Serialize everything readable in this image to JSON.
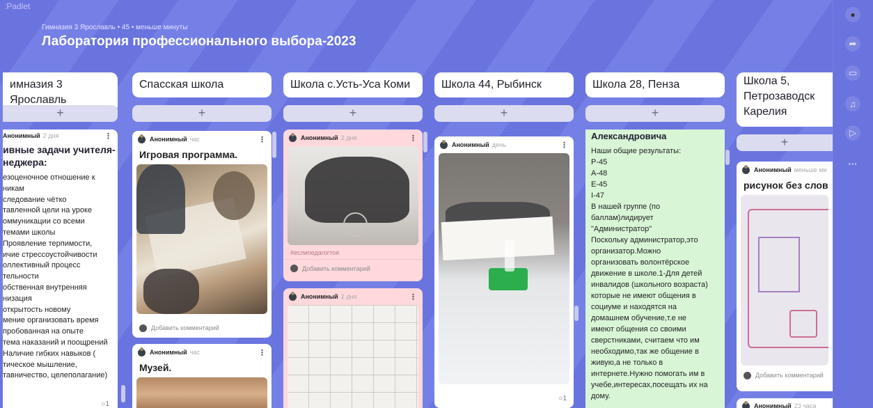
{
  "brand": ":Padlet",
  "breadcrumb": "Гимназия 3 Ярославль • 45 • меньше минуты",
  "title": "Лаборатория профессионального выбора-2023",
  "add_symbol": "+",
  "more_symbol": "⋮",
  "rail": {
    "share_icon": "share-icon",
    "present_icon": "slideshow-icon",
    "notify_icon": "bell-icon",
    "play_icon": "play-icon",
    "more": "···"
  },
  "columns": [
    {
      "heading": "имназия 3 Ярославль"
    },
    {
      "heading": "Спасская школа"
    },
    {
      "heading": "Школа с.Усть-Уса Коми"
    },
    {
      "heading": "Школа 44, Рыбинск"
    },
    {
      "heading": "Школа 28, Пенза"
    },
    {
      "heading": "Школа 5, Петрозаводск Карелия"
    }
  ],
  "col1": {
    "author": "Анонимный",
    "time": "2 дня",
    "title": "ивные задачи учителя-\nнеджера:",
    "lines": [
      "езоценочное отношение к",
      "никам",
      "следование чётко",
      "тавленной цели на уроке",
      "оммуникации со всеми",
      "темами школы",
      "Проявление терпимости,",
      "ичие стрессоустойчивости",
      "оллективный процесс",
      "тельности",
      "обственная внутренняя",
      "низация",
      "открытость новому",
      "мение организовать время",
      "пробованная на опыте",
      "тема наказаний и поощрений",
      "Наличие гибких навыков (",
      "тическое мышление,",
      "тавничество, целеполагание)"
    ],
    "comment_count": "1"
  },
  "col2": {
    "card1": {
      "author": "Анонимный",
      "time": "час",
      "title": "Игровая программа.",
      "comment": "Добавить комментарий"
    },
    "card2": {
      "author": "Анонимный",
      "time": "час",
      "title": "Музей."
    }
  },
  "col3": {
    "card1": {
      "author": "Анонимный",
      "time": "2 дня",
      "tag": "#еслипедагогтоя",
      "comment": "Добавить комментарий"
    },
    "card2": {
      "author": "Анонимный",
      "time": "2 дня"
    }
  },
  "col4": {
    "card1": {
      "author": "Анонимный",
      "time": "день",
      "comment_count": "1"
    }
  },
  "col5": {
    "title": "Александровича",
    "lines": [
      "Наши общие результаты:",
      "Р-45",
      "А-48",
      "Е-45",
      "I-47",
      "В нашей группе (по",
      "баллам)лидирует",
      "\"Администратор\"",
      "Поскольку администратор,это",
      "организатор.Можно",
      "организовать волонтёрское",
      "движение в школе.1-Для детей",
      "инвалидов (школьного возраста)",
      "которые не имеют общения в",
      "социуме и находятся на",
      "домашнем обучение,т.е не",
      "имеют общения со своими",
      "сверстниками, считаем что им",
      "необходимо,так же общение в",
      "живую,а не только в",
      "интернете.Нужно помогать им в",
      "учебе,интересах,посещать их на",
      "дому."
    ]
  },
  "col6": {
    "card1": {
      "author": "Анонимный",
      "time": "меньше ми",
      "title": "рисунок без слов",
      "comment": "Добавить комментарий"
    },
    "card2": {
      "author": "Анонимный",
      "time": "23 часа"
    }
  }
}
